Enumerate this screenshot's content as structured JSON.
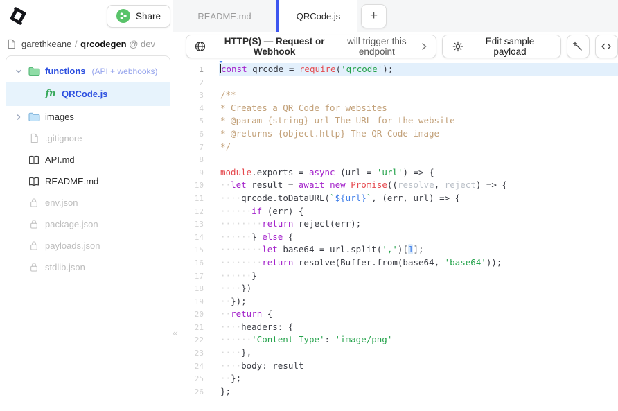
{
  "topbar": {
    "share_label": "Share",
    "tabs": [
      {
        "label": "README.md",
        "active": false
      },
      {
        "label": "QRCode.js",
        "active": true
      }
    ],
    "new_tab_label": "+"
  },
  "sidebar": {
    "repo": {
      "owner": "garethkeane",
      "separator": "/",
      "name": "qrcodegen",
      "branch_label": "@ dev"
    },
    "items": [
      {
        "label": "functions",
        "note": "(API + webhooks)",
        "icon": "folder-icon",
        "folder_color": "green",
        "chevron": "down",
        "level": "top",
        "link": true
      },
      {
        "label": "QRCode.js",
        "icon": "fn-icon",
        "level": "nested",
        "selected": true,
        "link": true
      },
      {
        "label": "images",
        "icon": "folder-icon",
        "folder_color": "blue",
        "chevron": "right",
        "level": "top"
      },
      {
        "label": ".gitignore",
        "icon": "file-icon",
        "level": "file",
        "muted": true
      },
      {
        "label": "API.md",
        "icon": "book-icon",
        "level": "file"
      },
      {
        "label": "README.md",
        "icon": "book-icon",
        "level": "file"
      },
      {
        "label": "env.json",
        "icon": "lock-icon",
        "level": "file",
        "muted": true
      },
      {
        "label": "package.json",
        "icon": "lock-icon",
        "level": "file",
        "muted": true
      },
      {
        "label": "payloads.json",
        "icon": "lock-icon",
        "level": "file",
        "muted": true
      },
      {
        "label": "stdlib.json",
        "icon": "lock-icon",
        "level": "file",
        "muted": true
      }
    ]
  },
  "toolbar": {
    "trigger_bold": "HTTP(S) — Request or Webhook",
    "trigger_rest": "will trigger this endpoint",
    "edit_payload_label": "Edit sample payload"
  },
  "collapse_label": "«",
  "editor": {
    "language": "javascript",
    "filename": "QRCode.js",
    "lines": [
      {
        "n": 1,
        "hl": true,
        "cursor": true,
        "seg": [
          [
            "k",
            "const"
          ],
          [
            "d",
            " qrcode = "
          ],
          [
            "b",
            "require"
          ],
          [
            "d",
            "("
          ],
          [
            "s",
            "'qrcode'"
          ],
          [
            "d",
            ");"
          ]
        ]
      },
      {
        "n": 2,
        "seg": []
      },
      {
        "n": 3,
        "seg": [
          [
            "c",
            "/**"
          ]
        ]
      },
      {
        "n": 4,
        "seg": [
          [
            "c",
            "* Creates a QR Code for websites"
          ]
        ]
      },
      {
        "n": 5,
        "seg": [
          [
            "c",
            "* @param {string} url The URL for the website"
          ]
        ]
      },
      {
        "n": 6,
        "seg": [
          [
            "c",
            "* @returns {object.http} The QR Code image"
          ]
        ]
      },
      {
        "n": 7,
        "seg": [
          [
            "c",
            "*/"
          ]
        ]
      },
      {
        "n": 8,
        "seg": []
      },
      {
        "n": 9,
        "seg": [
          [
            "b",
            "module"
          ],
          [
            "d",
            ".exports = "
          ],
          [
            "k",
            "async"
          ],
          [
            "d",
            " (url = "
          ],
          [
            "s",
            "'url'"
          ],
          [
            "d",
            ") => {"
          ]
        ]
      },
      {
        "n": 10,
        "seg": [
          [
            "w",
            "··"
          ],
          [
            "k",
            "let"
          ],
          [
            "d",
            " result = "
          ],
          [
            "k",
            "await"
          ],
          [
            "d",
            " "
          ],
          [
            "k",
            "new"
          ],
          [
            "d",
            " "
          ],
          [
            "b",
            "Promise"
          ],
          [
            "d",
            "(("
          ],
          [
            "p",
            "resolve"
          ],
          [
            "d",
            ", "
          ],
          [
            "p",
            "reject"
          ],
          [
            "d",
            ") => {"
          ]
        ]
      },
      {
        "n": 11,
        "seg": [
          [
            "w",
            "····"
          ],
          [
            "d",
            "qrcode.toDataURL("
          ],
          [
            "s",
            "`"
          ],
          [
            "t",
            "${url}"
          ],
          [
            "s",
            "`"
          ],
          [
            "d",
            ", (err, url) => {"
          ]
        ]
      },
      {
        "n": 12,
        "seg": [
          [
            "w",
            "······"
          ],
          [
            "k",
            "if"
          ],
          [
            "d",
            " (err) {"
          ]
        ]
      },
      {
        "n": 13,
        "seg": [
          [
            "w",
            "········"
          ],
          [
            "k",
            "return"
          ],
          [
            "d",
            " reject(err);"
          ]
        ]
      },
      {
        "n": 14,
        "seg": [
          [
            "w",
            "······"
          ],
          [
            "d",
            "} "
          ],
          [
            "k",
            "else"
          ],
          [
            "d",
            " {"
          ]
        ]
      },
      {
        "n": 15,
        "seg": [
          [
            "w",
            "········"
          ],
          [
            "k",
            "let"
          ],
          [
            "d",
            " base64 = url.split("
          ],
          [
            "s",
            "','"
          ],
          [
            "d",
            ")["
          ],
          [
            "m",
            "1"
          ],
          [
            "d",
            "];"
          ]
        ]
      },
      {
        "n": 16,
        "seg": [
          [
            "w",
            "········"
          ],
          [
            "k",
            "return"
          ],
          [
            "d",
            " resolve(Buffer.from(base64, "
          ],
          [
            "s",
            "'base64'"
          ],
          [
            "d",
            "));"
          ]
        ]
      },
      {
        "n": 17,
        "seg": [
          [
            "w",
            "······"
          ],
          [
            "d",
            "}"
          ]
        ]
      },
      {
        "n": 18,
        "seg": [
          [
            "w",
            "····"
          ],
          [
            "d",
            "})"
          ]
        ]
      },
      {
        "n": 19,
        "seg": [
          [
            "w",
            "··"
          ],
          [
            "d",
            "});"
          ]
        ]
      },
      {
        "n": 20,
        "seg": [
          [
            "w",
            "··"
          ],
          [
            "k",
            "return"
          ],
          [
            "d",
            " {"
          ]
        ]
      },
      {
        "n": 21,
        "seg": [
          [
            "w",
            "····"
          ],
          [
            "d",
            "headers: {"
          ]
        ]
      },
      {
        "n": 22,
        "seg": [
          [
            "w",
            "······"
          ],
          [
            "s",
            "'Content-Type'"
          ],
          [
            "d",
            ": "
          ],
          [
            "s",
            "'image/png'"
          ]
        ]
      },
      {
        "n": 23,
        "seg": [
          [
            "w",
            "····"
          ],
          [
            "d",
            "},"
          ]
        ]
      },
      {
        "n": 24,
        "seg": [
          [
            "w",
            "····"
          ],
          [
            "d",
            "body: result"
          ]
        ]
      },
      {
        "n": 25,
        "seg": [
          [
            "w",
            "··"
          ],
          [
            "d",
            "};"
          ]
        ]
      },
      {
        "n": 26,
        "seg": [
          [
            "d",
            "};"
          ]
        ]
      }
    ]
  },
  "colors": {
    "accent_blue": "#3d56f0",
    "share_green": "#59c36a",
    "selected_row_blue": "#e7f3fc",
    "folder_green": "#8fdca6",
    "folder_blue": "#c3e3f9",
    "line_highlight": "#e3f0fc"
  }
}
